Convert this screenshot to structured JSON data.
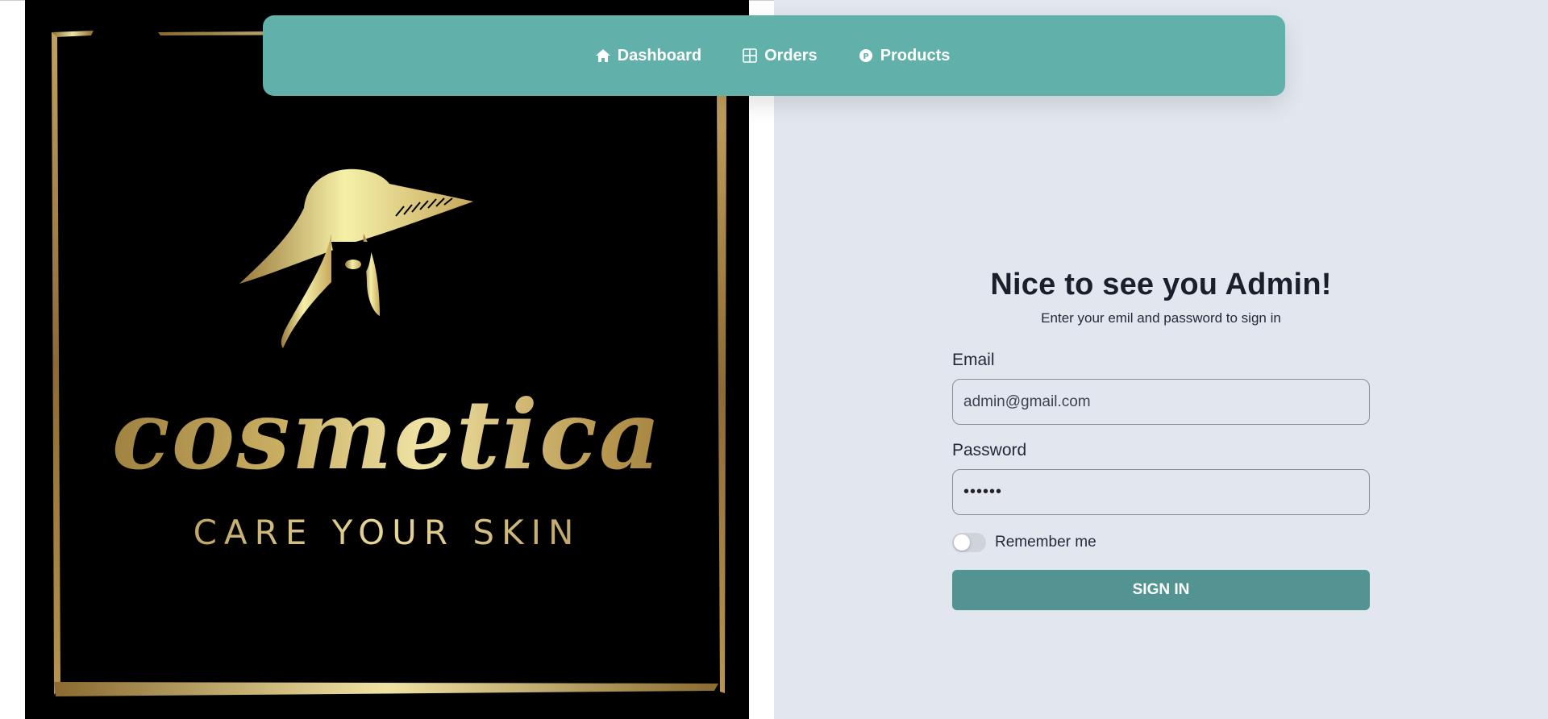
{
  "hero": {
    "brand": "cosmetica",
    "tagline": "CARE YOUR SKIN"
  },
  "nav": {
    "items": [
      {
        "label": "Dashboard",
        "icon": "home-icon"
      },
      {
        "label": "Orders",
        "icon": "grid-icon"
      },
      {
        "label": "Products",
        "icon": "product-circle-icon"
      }
    ]
  },
  "signin": {
    "title": "Nice to see you Admin!",
    "subtitle": "Enter your emil and password to sign in",
    "email_label": "Email",
    "email_value": "admin@gmail.com",
    "password_label": "Password",
    "password_value": "••••••",
    "remember_label": "Remember me",
    "remember_on": false,
    "button_label": "SIGN IN"
  },
  "colors": {
    "nav_bg": "#61b0aa",
    "button_bg": "#539492",
    "panel_bg": "#e2e6ee",
    "gold": "#c9ae62"
  }
}
